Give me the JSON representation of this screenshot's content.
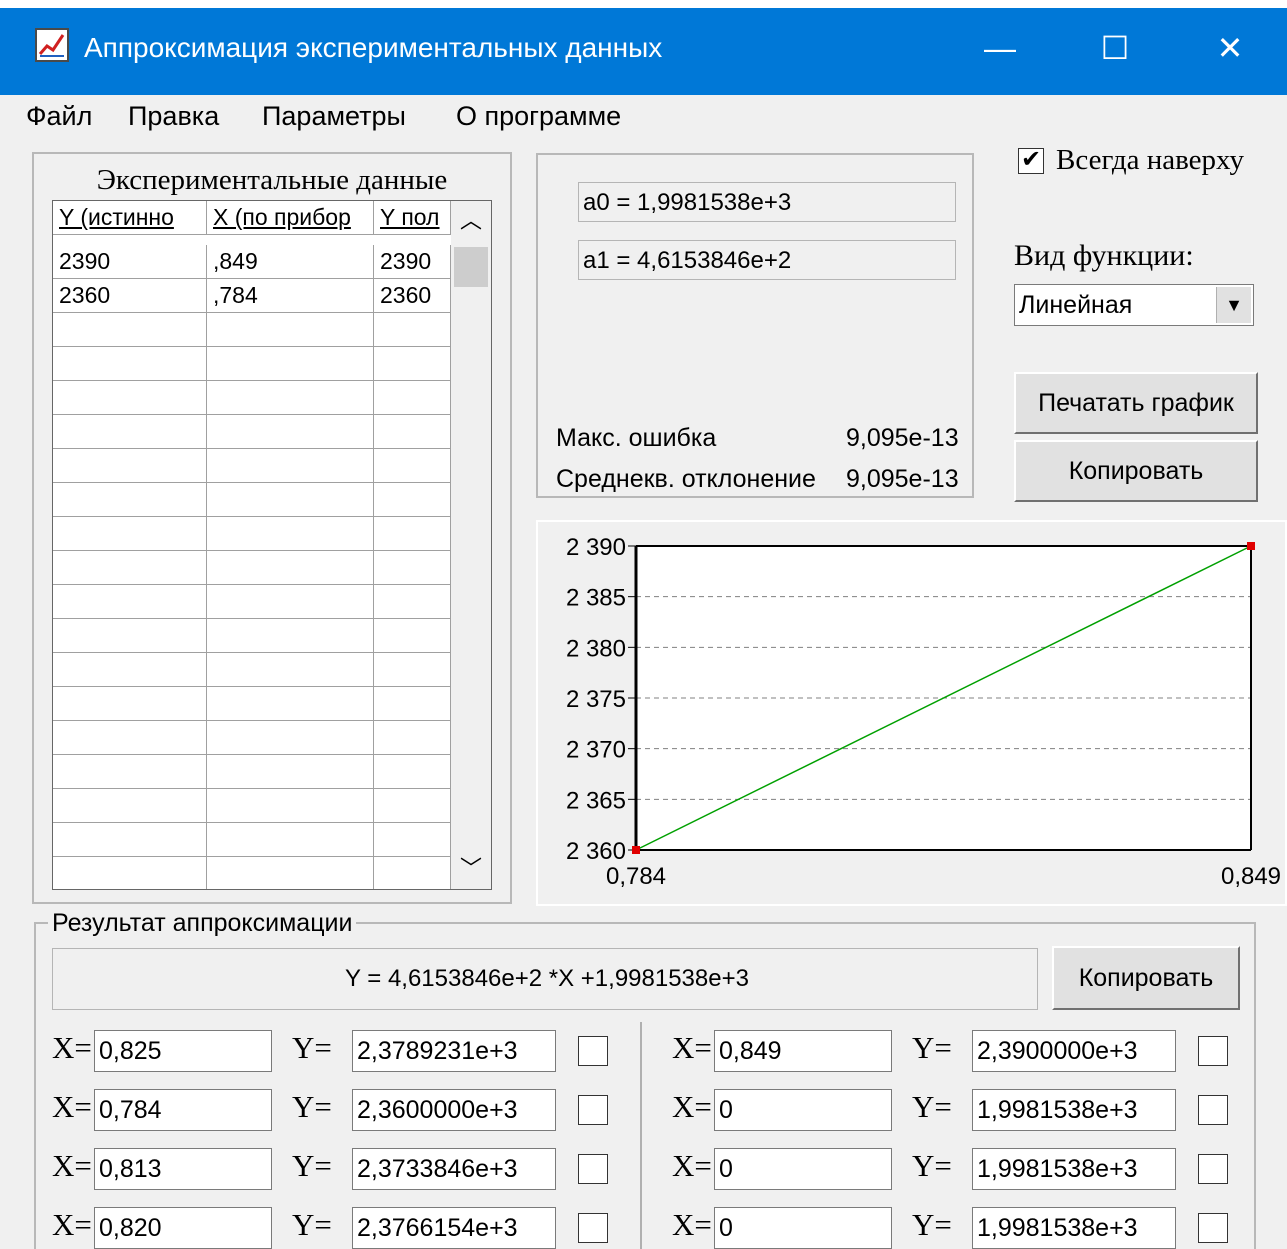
{
  "window": {
    "title": "Аппроксимация экспериментальных данных",
    "minimize": "—",
    "maximize": "☐",
    "close": "✕"
  },
  "menu": [
    "Файл",
    "Правка",
    "Параметры",
    "О программе"
  ],
  "data_panel": {
    "title": "Экспериментальные данные",
    "columns": [
      "Y (истинно",
      "X (по прибор",
      "Y пол"
    ],
    "rows": [
      [
        "2390",
        ",849",
        "2390"
      ],
      [
        "2360",
        ",784",
        "2360"
      ]
    ]
  },
  "coefficients": {
    "a0": "a0 = 1,9981538e+3",
    "a1": "a1 = 4,6153846e+2"
  },
  "stats": {
    "max_error_label": "Макс. ошибка",
    "max_error_value": "9,095e-13",
    "std_label": "Среднекв. отклонение",
    "std_value": "9,095e-13"
  },
  "options": {
    "always_on_top": "Всегда наверху",
    "always_on_top_checked": true,
    "function_label": "Вид функции:",
    "function_value": "Линейная",
    "print_button": "Печатать график",
    "copy_button": "Копировать"
  },
  "chart_data": {
    "type": "line",
    "x": [
      0.784,
      0.849
    ],
    "y": [
      2360,
      2390
    ],
    "points": [
      [
        0.784,
        2360
      ],
      [
        0.849,
        2390
      ]
    ],
    "xlim": [
      0.784,
      0.849
    ],
    "ylim": [
      2360,
      2390
    ],
    "x_tick_labels": [
      "0,784",
      "0,849"
    ],
    "y_ticks": [
      2390,
      2385,
      2380,
      2375,
      2370,
      2365,
      2360
    ],
    "y_tick_labels": [
      "2 390",
      "2 385",
      "2 380",
      "2 375",
      "2 370",
      "2 365",
      "2 360"
    ],
    "grid": "horizontal dashed",
    "colors": {
      "line": "#00a000",
      "points": "#e00000"
    }
  },
  "result": {
    "group_title": "Результат аппроксимации",
    "formula": "Y = 4,6153846e+2 *X  +1,9981538e+3",
    "copy_button": "Копировать",
    "x_label": "X=",
    "y_label": "Y=",
    "left_pairs": [
      {
        "x": "0,825",
        "y": "2,3789231e+3"
      },
      {
        "x": "0,784",
        "y": "2,3600000e+3"
      },
      {
        "x": "0,813",
        "y": "2,3733846e+3"
      },
      {
        "x": "0,820",
        "y": "2,3766154e+3"
      }
    ],
    "right_pairs": [
      {
        "x": "0,849",
        "y": "2,3900000e+3"
      },
      {
        "x": "0",
        "y": "1,9981538e+3"
      },
      {
        "x": "0",
        "y": "1,9981538e+3"
      },
      {
        "x": "0",
        "y": "1,9981538e+3"
      }
    ]
  }
}
